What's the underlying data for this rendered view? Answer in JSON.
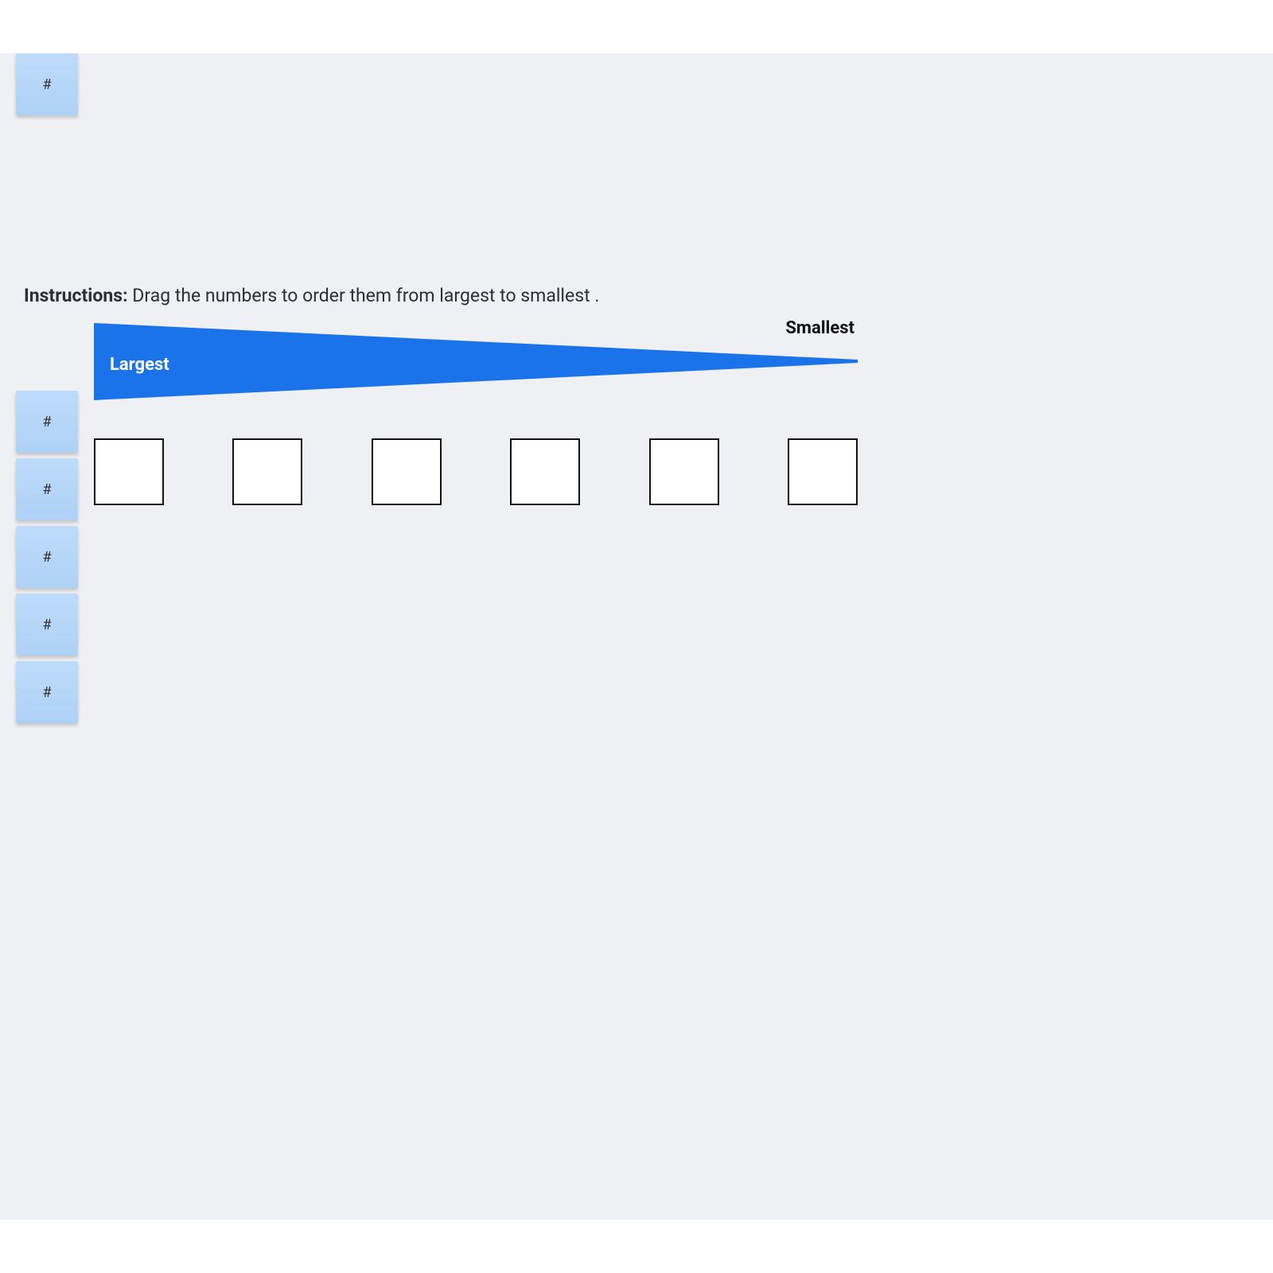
{
  "instructions": {
    "label": "Instructions:",
    "text": "Drag the numbers to order them from largest to smallest ."
  },
  "scale": {
    "left_label": "Largest",
    "right_label": "Smallest"
  },
  "tiles": [
    "#",
    "#",
    "#",
    "#",
    "#",
    "#"
  ],
  "colors": {
    "accent": "#1a73e8",
    "tile": "#b7d6fa",
    "panel_bg": "#eef0f3"
  }
}
